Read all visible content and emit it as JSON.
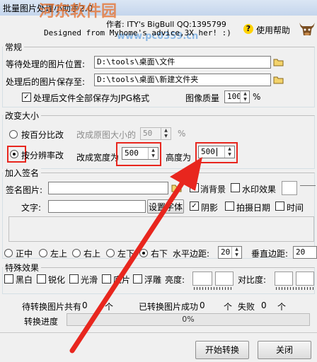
{
  "window": {
    "title": "批量图片处理小助手2.0",
    "watermark": "河东软件园",
    "watermark_url": "www.pc0359.cn",
    "author_line": "作者: ITY's BigBull QQ:1395799",
    "credit_line": "Designed from Myhome's advice,3X her! :)",
    "help_label": "使用帮助"
  },
  "common": {
    "title": "常规",
    "src_label": "等待处理的图片位置:",
    "src_value": "D:\\tools\\桌面\\文件",
    "dst_label": "处理后的图片保存至:",
    "dst_value": "D:\\tools\\桌面\\新建文件夹",
    "jpg_label": "处理后文件全部保存为JPG格式",
    "jpg_checked": true,
    "quality_label": "图像质量",
    "quality_value": "100",
    "quality_unit": "%"
  },
  "resize": {
    "title": "改变大小",
    "percent_label": "按百分比改",
    "percent_desc": "改成原图大小的",
    "percent_value": "50",
    "percent_unit": "%",
    "resolution_label": "按分辨率改",
    "width_label": "改成宽度为",
    "width_value": "500",
    "height_label": "高度为",
    "height_value": "500"
  },
  "signature": {
    "title": "加入签名",
    "image_label": "签名图片:",
    "image_value": "",
    "transparent_label": "消背景",
    "watermark_label": "水印效果",
    "text_label": "文字:",
    "text_value": "",
    "font_button": "设置字体",
    "shadow_label": "阴影",
    "shoot_date_label": "拍摄日期",
    "time_label": "时间",
    "positions": [
      "正中",
      "左上",
      "右上",
      "左下",
      "右下"
    ],
    "h_margin_label": "水平边距:",
    "h_margin_value": "20",
    "v_margin_label": "垂直边距:",
    "v_margin_value": "20"
  },
  "effects": {
    "title": "特殊效果",
    "items": [
      "黑白",
      "锐化",
      "光滑",
      "底片",
      "浮雕"
    ],
    "brightness_label": "亮度:",
    "contrast_label": "对比度:"
  },
  "status": {
    "pending_label": "待转换图片共有",
    "pending_value": "0",
    "unit": "个",
    "success_label": "已转换图片成功",
    "success_value": "0",
    "fail_label": "失败",
    "fail_value": "0",
    "progress_label": "转换进度",
    "progress_text": "0%"
  },
  "actions": {
    "start": "开始转换",
    "close": "关闭"
  },
  "colors": {
    "annotation_red": "#e8261e",
    "title_bar": "#c4d5ec"
  }
}
